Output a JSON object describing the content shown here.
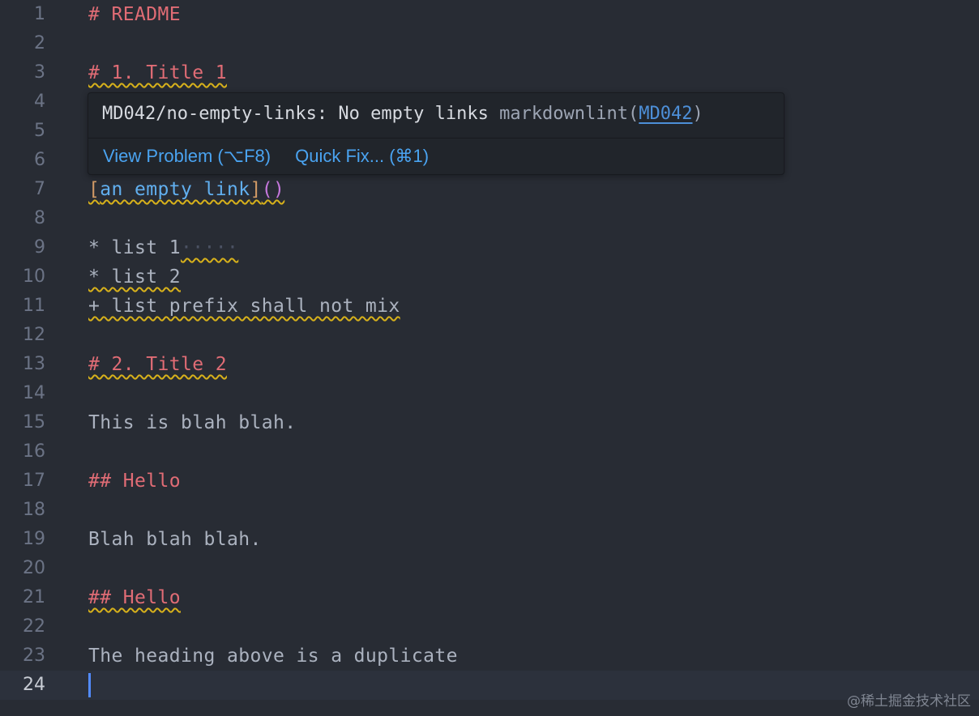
{
  "editor": {
    "lines": [
      {
        "num": "1",
        "parts": [
          {
            "t": "# README",
            "c": "tok-heading"
          }
        ]
      },
      {
        "num": "2",
        "parts": []
      },
      {
        "num": "3",
        "parts": [
          {
            "t": "# 1. Title 1",
            "c": "tok-heading",
            "sq": true
          }
        ]
      },
      {
        "num": "4",
        "parts": []
      },
      {
        "num": "5",
        "parts": []
      },
      {
        "num": "6",
        "parts": []
      },
      {
        "num": "7",
        "parts": [
          {
            "t": "[",
            "c": "tok-bracket",
            "sq": true
          },
          {
            "t": "an empty link",
            "c": "tok-link",
            "sq": true
          },
          {
            "t": "]",
            "c": "tok-bracket",
            "sq": true
          },
          {
            "t": "()",
            "c": "tok-paren",
            "sq": true
          }
        ]
      },
      {
        "num": "8",
        "parts": []
      },
      {
        "num": "9",
        "parts": [
          {
            "t": "* list 1",
            "c": "tok-text"
          },
          {
            "t": "·····",
            "c": "tok-ws",
            "sq": true
          }
        ]
      },
      {
        "num": "10",
        "parts": [
          {
            "t": "* list 2",
            "c": "tok-text",
            "sq": true
          }
        ]
      },
      {
        "num": "11",
        "parts": [
          {
            "t": "+ list prefix shall not mix",
            "c": "tok-text",
            "sq": true
          }
        ]
      },
      {
        "num": "12",
        "parts": []
      },
      {
        "num": "13",
        "parts": [
          {
            "t": "# 2. Title 2",
            "c": "tok-heading",
            "sq": true
          }
        ]
      },
      {
        "num": "14",
        "parts": []
      },
      {
        "num": "15",
        "parts": [
          {
            "t": "This is blah blah.",
            "c": "tok-text"
          }
        ]
      },
      {
        "num": "16",
        "parts": []
      },
      {
        "num": "17",
        "parts": [
          {
            "t": "## Hello",
            "c": "tok-heading"
          }
        ]
      },
      {
        "num": "18",
        "parts": []
      },
      {
        "num": "19",
        "parts": [
          {
            "t": "Blah blah blah.",
            "c": "tok-text"
          }
        ]
      },
      {
        "num": "20",
        "parts": []
      },
      {
        "num": "21",
        "parts": [
          {
            "t": "## Hello",
            "c": "tok-heading",
            "sq": true
          }
        ]
      },
      {
        "num": "22",
        "parts": []
      },
      {
        "num": "23",
        "parts": [
          {
            "t": "The heading above is a duplicate",
            "c": "tok-text"
          }
        ]
      },
      {
        "num": "24",
        "parts": [],
        "current": true
      }
    ]
  },
  "hover": {
    "rule": "MD042/no-empty-links: No empty links ",
    "source": "markdownlint(",
    "code": "MD042",
    "source_end": ")",
    "view_problem": "View Problem (⌥F8)",
    "quick_fix": "Quick Fix... (⌘1)"
  },
  "watermark": "@稀土掘金技术社区"
}
